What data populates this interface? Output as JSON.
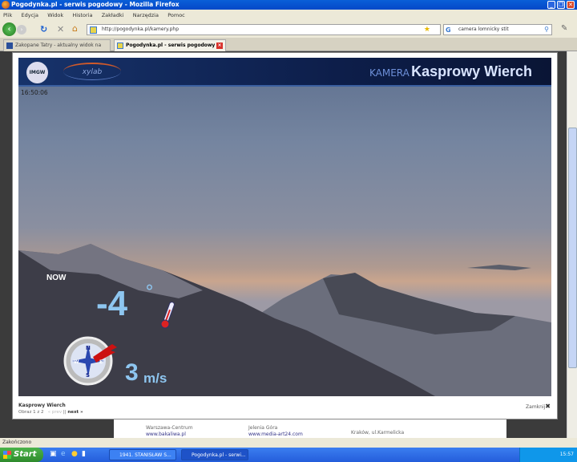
{
  "window": {
    "title": "Pogodynka.pl - serwis pogodowy - Mozilla Firefox"
  },
  "menu": [
    "Plik",
    "Edycja",
    "Widok",
    "Historia",
    "Zakładki",
    "Narzędzia",
    "Pomoc"
  ],
  "nav": {
    "url": "http://pogodynka.pl/kamery.php",
    "search": "camera lomnicky stit"
  },
  "tabs": [
    {
      "label": "Zakopane Tatry - aktualny widok na Ka..."
    },
    {
      "label": "Pogodynka.pl - serwis pogodowy"
    }
  ],
  "camera": {
    "logo1": "IMGW",
    "logo2": "xylab",
    "prefix": "KAMERA",
    "name": "Kasprowy Wierch",
    "timestamp": "16:50:06",
    "now_label": "NOW",
    "temperature": "-4",
    "degree": "°",
    "wind_speed": "3",
    "wind_unit": "m/s",
    "compass": [
      "N",
      "E",
      "S",
      "W"
    ]
  },
  "lightbox": {
    "caption": "Kasprowy Wierch",
    "image_label": "Obraz 1 z 2",
    "prev": "« prev",
    "separator": "||",
    "next": "next »",
    "close": "Zamknij"
  },
  "under": [
    "Warszawa-Centrum",
    "www.bakaliwa.pl",
    "Jelenia Góra",
    "www.media-art24.com",
    "Kraków, ul.Karmelicka"
  ],
  "statusbar": "Zakończono",
  "taskbar": {
    "start": "Start",
    "tasks": [
      "1941. STANISŁAW S...",
      "Pogodynka.pl - serwi..."
    ],
    "clock": "15:57"
  }
}
